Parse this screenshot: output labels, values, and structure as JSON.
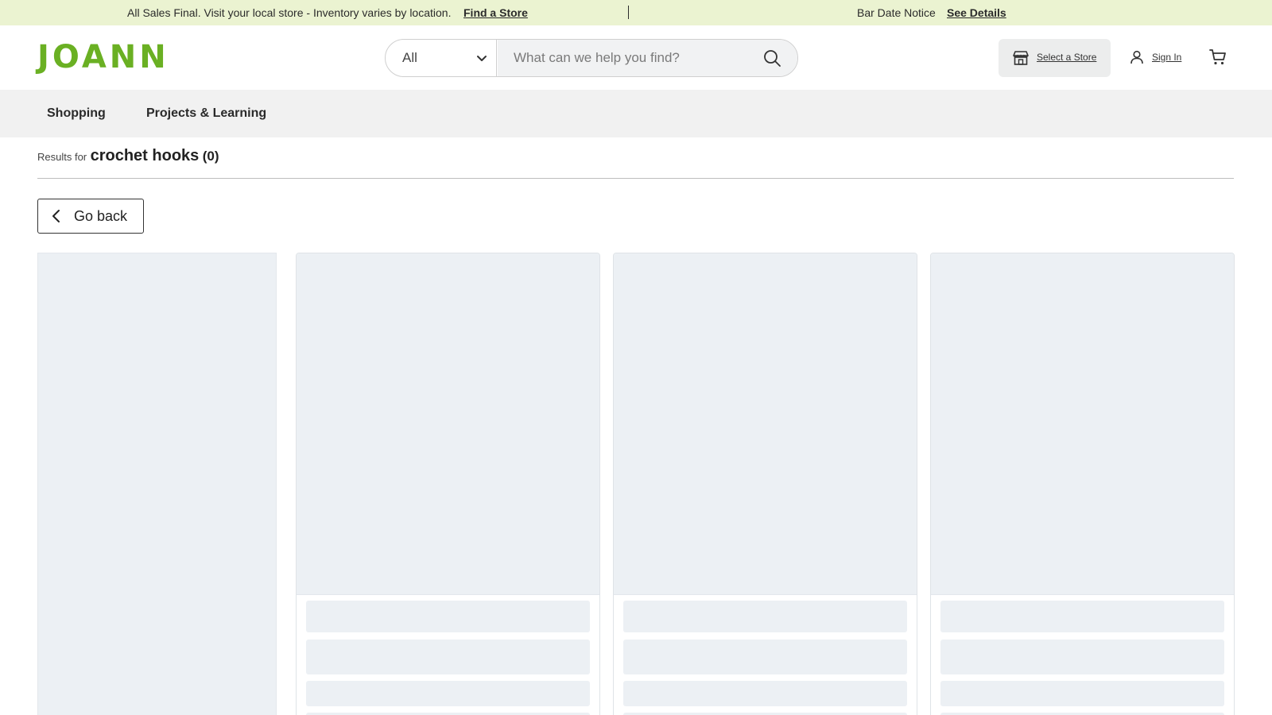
{
  "announcement": {
    "message": "All Sales Final. Visit your local store - Inventory varies by location.",
    "find_store_link": "Find a Store",
    "notice": "Bar Date Notice",
    "details_link": "See Details"
  },
  "header": {
    "logo_text": "JOANN",
    "brand_color": "#6ab023",
    "search": {
      "category": "All",
      "placeholder": "What can we help you find?"
    },
    "select_store": "Select a Store",
    "sign_in": "Sign In",
    "icons": [
      "chevron-down-icon",
      "search-icon",
      "store-icon",
      "user-icon",
      "cart-icon",
      "chevron-left-icon"
    ]
  },
  "nav": {
    "items": [
      "Shopping",
      "Projects & Learning"
    ]
  },
  "results": {
    "prefix": "Results for",
    "query": "crochet hooks",
    "count": "(0)"
  },
  "go_back": "Go back"
}
